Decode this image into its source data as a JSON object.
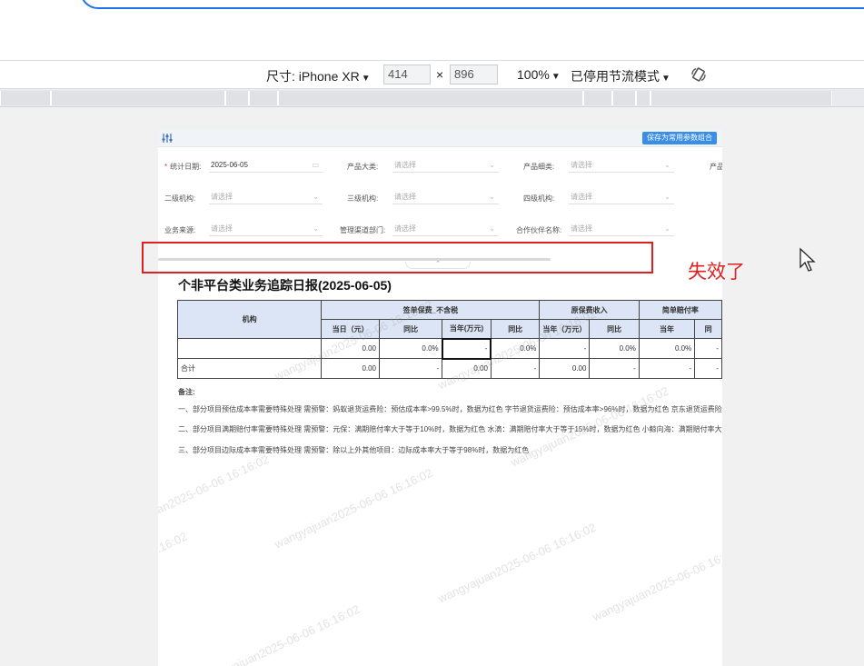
{
  "toolbar": {
    "dimensions_label": "尺寸: iPhone XR",
    "width_value": "414",
    "times": "×",
    "height_value": "896",
    "zoom": "100%",
    "throttle": "已停用节流模式"
  },
  "report": {
    "save_button": "保存为常用参数组合",
    "filters": [
      {
        "label": "统计日期:",
        "value": "2025-06-05",
        "required": true,
        "icon": "calendar-icon"
      },
      {
        "label": "产品大类:",
        "placeholder": "请选择"
      },
      {
        "label": "产品细类:",
        "placeholder": "请选择"
      },
      {
        "label": "产品"
      },
      {
        "label": "二级机构:",
        "placeholder": "请选择"
      },
      {
        "label": "三级机构:",
        "placeholder": "请选择"
      },
      {
        "label": "四级机构:",
        "placeholder": "请选择"
      },
      {
        "label": "业务来源:",
        "placeholder": "请选择"
      },
      {
        "label": "管理渠道部门:",
        "placeholder": "请选择"
      },
      {
        "label": "合作伙伴名称:",
        "placeholder": "请选择"
      }
    ],
    "title": "个非平台类业务追踪日报(2025-06-05)",
    "table": {
      "col_org": "机构",
      "group1": "签单保费_不含税",
      "group2": "原保费收入",
      "group3": "简单赔付率",
      "sub1": "当日（元）",
      "sub2": "同比",
      "sub3": "当年(万元)",
      "sub4": "同比",
      "sub5": "当年（万元）",
      "sub6": "同比",
      "sub7": "当年",
      "sub8": "同",
      "row1": [
        "",
        "0.00",
        "0.0%",
        "-",
        "0.0%",
        "-",
        "0.0%",
        "0.0%",
        "-"
      ],
      "row2": [
        "合计",
        "0.00",
        "-",
        "0.00",
        "-",
        "0.00",
        "-",
        "-",
        "-"
      ]
    },
    "notes_title": "备注:",
    "notes": [
      "一、部分项目预估成本率需要特殊处理 需预警：蚂蚁退货运费险：预估成本率>99.5%时，数据为红色 字节退货运费险：预估成本率>96%时，数据为红色 京东退货运费险：预估",
      "二、部分项目满期赔付率需要特殊处理 需预警：元保：满期赔付率大于等于10%时，数据为红色  水滴：满期赔付率大于等于15%时，数据为红色  小鲸向海：满期赔付率大于等",
      "三、部分项目边际成本率需要特殊处理 需预警：除以上外其他项目：边际成本率大于等于98%时，数据为红色"
    ],
    "watermark": "wangyajuan2025-06-06 16:16:02"
  },
  "annotation": {
    "text": "失效了",
    "color": "#e02020"
  }
}
